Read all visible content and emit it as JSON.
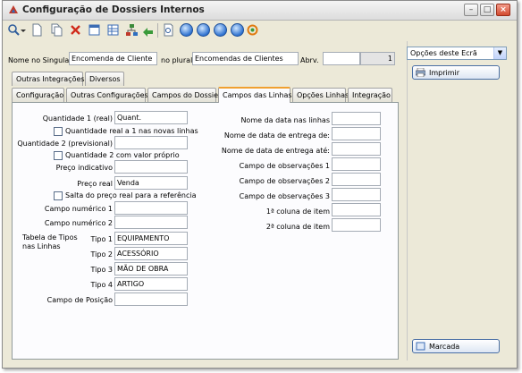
{
  "window": {
    "title": "Configuração de Dossiers Internos"
  },
  "header": {
    "singular_label": "Nome no Singular",
    "singular_value": "Encomenda de Cliente",
    "plural_label": "no plural",
    "plural_value": "Encomendas de Clientes",
    "abrv_label": "Abrv.",
    "abrv_value": "",
    "number_value": "1"
  },
  "tabs_row1": [
    "Outras Integrações",
    "Diversos"
  ],
  "tabs_row2": [
    "Configuração",
    "Outras Configurações",
    "Campos do Dossier",
    "Campos das Linhas",
    "Opções Linhas",
    "Integração"
  ],
  "active_tab": "Campos das Linhas",
  "left": {
    "qty1_label": "Quantidade 1 (real)",
    "qty1_value": "Quant.",
    "chk1_label": "Quantidade real a 1 nas novas linhas",
    "qty2_label": "Quantidade 2 (previsional)",
    "qty2_value": "",
    "chk2_label": "Quantidade 2 com valor próprio",
    "price_ind_label": "Preço indicativo",
    "price_ind_value": "",
    "price_real_label": "Preço real",
    "price_real_value": "Venda",
    "chk3_label": "Salta do preço real para a referência",
    "num1_label": "Campo numérico 1",
    "num1_value": "",
    "num2_label": "Campo numérico 2",
    "num2_value": "",
    "types_label": "Tabela de Tipos nas Linhas",
    "type1_label": "Tipo 1",
    "type1_value": "EQUIPAMENTO",
    "type2_label": "Tipo 2",
    "type2_value": "ACESSÓRIO",
    "type3_label": "Tipo 3",
    "type3_value": "MÃO DE OBRA",
    "type4_label": "Tipo 4",
    "type4_value": "ARTIGO",
    "pos_label": "Campo de Posição",
    "pos_value": ""
  },
  "right": {
    "date_label": "Nome da data nas linhas",
    "deliv_from_label": "Nome de data de entrega de:",
    "deliv_to_label": "Nome de data de entrega até:",
    "obs1_label": "Campo de observações 1",
    "obs2_label": "Campo de observações 2",
    "obs3_label": "Campo de observações 3",
    "col1_label": "1ª coluna de item",
    "col2_label": "2ª coluna de item"
  },
  "side": {
    "options_select": "Opções deste Ecrã",
    "print_button": "Imprimir",
    "marked_button": "Marcada"
  },
  "colors": {
    "active_tab_accent": "#f0a030",
    "button_border": "#4a6fa5",
    "panel_bg": "#fcfcfe"
  }
}
